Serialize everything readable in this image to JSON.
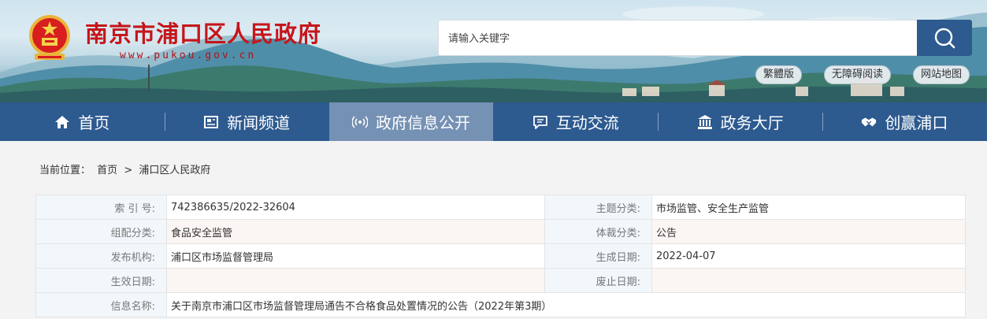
{
  "header": {
    "site_title": "南京市浦口区人民政府",
    "site_url": "www.pukou.gov.cn",
    "search_placeholder": "请输入关键字",
    "quick_links": [
      "繁體版",
      "无障碍阅读",
      "网站地图"
    ]
  },
  "nav": {
    "items": [
      {
        "label": "首页",
        "icon": "home-icon"
      },
      {
        "label": "新闻频道",
        "icon": "newspaper-icon"
      },
      {
        "label": "政府信息公开",
        "icon": "broadcast-icon"
      },
      {
        "label": "互动交流",
        "icon": "chat-icon"
      },
      {
        "label": "政务大厅",
        "icon": "building-icon"
      },
      {
        "label": "创赢浦口",
        "icon": "handshake-icon"
      }
    ],
    "active_index": 2
  },
  "breadcrumb": {
    "prefix": "当前位置：",
    "items": [
      "首页",
      "浦口区人民政府"
    ],
    "separator": ">"
  },
  "info": {
    "rows": [
      {
        "l1": "索 引 号:",
        "v1": "742386635/2022-32604",
        "l2": "主题分类:",
        "v2": "市场监管、安全生产监管"
      },
      {
        "l1": "组配分类:",
        "v1": "食品安全监管",
        "l2": "体裁分类:",
        "v2": "公告"
      },
      {
        "l1": "发布机构:",
        "v1": "浦口区市场监督管理局",
        "l2": "生成日期:",
        "v2": "2022-04-07"
      },
      {
        "l1": "生效日期:",
        "v1": "",
        "l2": "废止日期:",
        "v2": ""
      }
    ],
    "title_label": "信息名称:",
    "title_value": "关于南京市浦口区市场监督管理局通告不合格食品处置情况的公告（2022年第3期）"
  },
  "colors": {
    "title_red": "#c5161b",
    "nav_blue": "#2d5a8f",
    "nav_active": "#7591b4",
    "label_bg": "#f2f7fb"
  }
}
